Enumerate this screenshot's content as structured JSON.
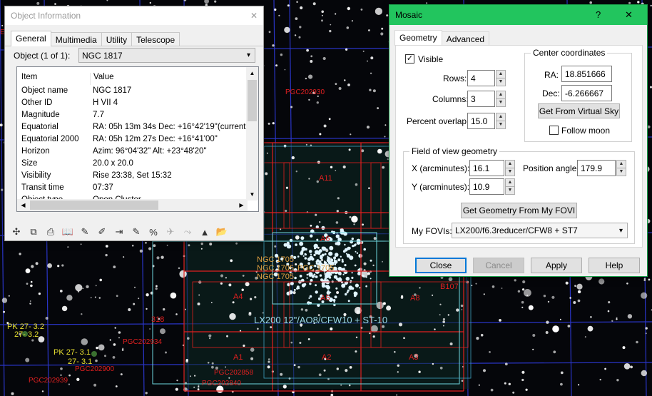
{
  "sky": {
    "labels_red": [
      "PGC202930",
      "A11",
      "A6",
      "A5",
      "A8",
      "A4",
      "A1",
      "A2",
      "A3",
      "B107",
      "318",
      "PGC202934",
      "PGC202900",
      "PGC202939",
      "PGC202858",
      "PGC202840"
    ],
    "labels_orange": [
      "NGC 1705",
      "NGC 1705",
      "NGC 1705",
      "PGC 1705"
    ],
    "labels_yellow": [
      "PK 27- 3.2",
      "27- 3.2",
      "PK 27- 3.1",
      "27- 3.1"
    ],
    "fov_label": "LX200 12\"/AO8/CFW10 + ST-10",
    "edge_label_top_left": "E"
  },
  "object_info": {
    "title": "Object Information",
    "tabs": [
      "General",
      "Multimedia",
      "Utility",
      "Telescope"
    ],
    "object_label": "Object (1 of 1):",
    "object_value": "NGC 1817",
    "columns": [
      "Item",
      "Value"
    ],
    "rows": [
      {
        "item": "Object name",
        "value": "NGC 1817"
      },
      {
        "item": "Other ID",
        "value": "H VII 4"
      },
      {
        "item": "Magnitude",
        "value": "7.7"
      },
      {
        "item": "Equatorial",
        "value": "RA: 05h 13m 34s   Dec: +16°42'19\"(current"
      },
      {
        "item": "Equatorial 2000",
        "value": "RA: 05h 12m 27s   Dec: +16°41'00\""
      },
      {
        "item": "Horizon",
        "value": "Azim: 96°04'32\"   Alt: +23°48'20\""
      },
      {
        "item": "Size",
        "value": "20.0 x 20.0"
      },
      {
        "item": "Visibility",
        "value": "Rise 23:38,  Set 15:32"
      },
      {
        "item": "Transit time",
        "value": "07:37"
      },
      {
        "item": "Object type",
        "value": "Open Cluster"
      }
    ],
    "toolbar_icons": [
      "center-icon",
      "copy-icon",
      "print-icon",
      "book-icon",
      "pencil-icon",
      "note-icon",
      "arrow-icon",
      "chart-icon",
      "ratio-icon",
      "telescope-icon",
      "slew-icon",
      "up-icon",
      "folder-icon"
    ],
    "toolbar_glyphs": [
      "✣",
      "⧉",
      "⎙",
      "📖",
      "✎",
      "✐",
      "⇥",
      "✎",
      "%",
      "✈",
      "⤳",
      "▲",
      "📂"
    ]
  },
  "mosaic": {
    "title": "Mosaic",
    "help_glyph": "?",
    "close_glyph": "✕",
    "tabs": [
      "Geometry",
      "Advanced"
    ],
    "visible_label": "Visible",
    "rows_label": "Rows:",
    "rows_value": "4",
    "columns_label": "Columns:",
    "columns_value": "3",
    "overlap_label": "Percent overlap:",
    "overlap_value": "15.0",
    "center_title": "Center coordinates",
    "ra_label": "RA:",
    "ra_value": "18.851666",
    "dec_label": "Dec:",
    "dec_value": "-6.266667",
    "get_sky_button": "Get From Virtual Sky",
    "follow_moon_label": "Follow moon",
    "fov_title": "Field of view geometry",
    "x_label": "X (arcminutes):",
    "x_value": "16.1",
    "y_label": "Y (arcminutes):",
    "y_value": "10.9",
    "pa_label": "Position angle:",
    "pa_value": "179.9",
    "get_geometry_button": "Get Geometry From My FOVI",
    "my_fovis_label": "My FOVIs:",
    "my_fovis_value": "LX200/f6.3reducer/CFW8 + ST7",
    "close_button": "Close",
    "cancel_button": "Cancel",
    "apply_button": "Apply",
    "help_button": "Help"
  }
}
